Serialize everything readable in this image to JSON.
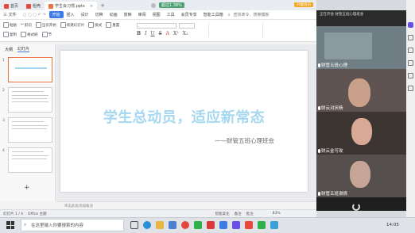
{
  "titlebar": {
    "tabs": [
      {
        "label": "首页",
        "color": "#e8473b"
      },
      {
        "label": "稻壳",
        "color": "#e8473b"
      },
      {
        "label": "学生会习惯.pptx",
        "color": "#e8743b"
      }
    ],
    "center_status": "超过1.38%",
    "right_label": "升级会员"
  },
  "menubar": {
    "file_label": "三 文件",
    "items": [
      "开始",
      "插入",
      "设计",
      "切换",
      "动画",
      "放映",
      "审阅",
      "视图",
      "工具",
      "会员专享",
      "智能工具箱"
    ],
    "start_label": "开始",
    "search_placeholder": "查找命令、搜索模板"
  },
  "toolbar": {
    "buttons": [
      "粘贴",
      "剪切",
      "复制",
      "格式刷",
      "当页开始",
      "新建幻灯片",
      "版式",
      "节",
      "重置"
    ],
    "format_buttons": [
      "B",
      "I",
      "U",
      "S",
      "A",
      "X²",
      "X₂"
    ]
  },
  "leftpane": {
    "tab_outline": "大纲",
    "tab_slides": "幻灯片",
    "slide_numbers": [
      "1",
      "2",
      "3",
      "4"
    ]
  },
  "slide": {
    "title": "学生总动员，适应新常态",
    "subtitle": "——财管五班心理班会"
  },
  "notes_placeholder": "单击此处添加备注",
  "statusbar": {
    "slide_info": "幻灯片 1 / 4",
    "theme": "Office 主题",
    "smart_beautify": "智能美化",
    "notes": "备注",
    "comments": "批注",
    "zoom": "83%"
  },
  "meeting": {
    "header": "正在开会 财管五班心理班会",
    "participants": [
      {
        "name": "财管五班心理",
        "color": "#7a8a92"
      },
      {
        "name": "财云对厌杨",
        "color": "#b48f7a"
      },
      {
        "name": "财云金可玫",
        "color": "#c69a88"
      },
      {
        "name": "财管五班谢倩",
        "color": "#9a8c86"
      }
    ]
  },
  "taskbar": {
    "search_placeholder": "在这里输入你要搜索的内容",
    "time": "14:05"
  },
  "colors": {
    "accent": "#3c7be6",
    "wps_orange": "#e8743b",
    "title_blue": "#a5d8f0"
  }
}
